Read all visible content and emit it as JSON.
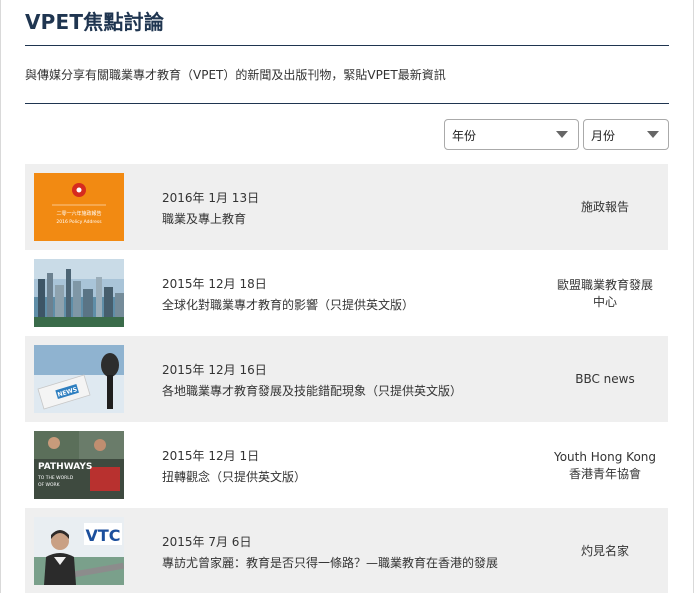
{
  "page": {
    "title": "VPET焦點討論",
    "intro": "與傳媒分享有關職業專才教育（VPET）的新聞及出版刊物，緊貼VPET最新資訊"
  },
  "filters": {
    "year_label": "年份",
    "month_label": "月份"
  },
  "articles": [
    {
      "date": "2016年 1月 13日",
      "title": "職業及專上教育",
      "source": [
        "施政報告"
      ],
      "thumb_icon": "policy-address-cover",
      "thumb_text": [
        "二零一六年施政報告",
        "2016 Policy Address"
      ]
    },
    {
      "date": "2015年 12月 18日",
      "title": "全球化對職業專才教育的影響（只提供英文版）",
      "source": [
        "歐盟職業教育發展",
        "中心"
      ],
      "thumb_icon": "city-skyline-photo"
    },
    {
      "date": "2015年 12月 16日",
      "title": "各地職業專才教育發展及技能錯配現象（只提供英文版）",
      "source": [
        "BBC news"
      ],
      "thumb_icon": "news-microphone-photo",
      "thumb_text": [
        "NEWS"
      ]
    },
    {
      "date": "2015年 12月 1日",
      "title": "扭轉觀念（只提供英文版）",
      "source": [
        "Youth Hong Kong",
        "香港青年協會"
      ],
      "thumb_icon": "pathways-cover",
      "thumb_text": [
        "PATHWAYS",
        "TO THE WORLD",
        "OF WORK"
      ]
    },
    {
      "date": "2015年 7月 6日",
      "title": "專訪尤曾家麗：教育是否只得一條路？—職業教育在香港的發展",
      "source": [
        "灼見名家"
      ],
      "thumb_icon": "interview-photo",
      "thumb_text": [
        "VTC"
      ]
    }
  ]
}
